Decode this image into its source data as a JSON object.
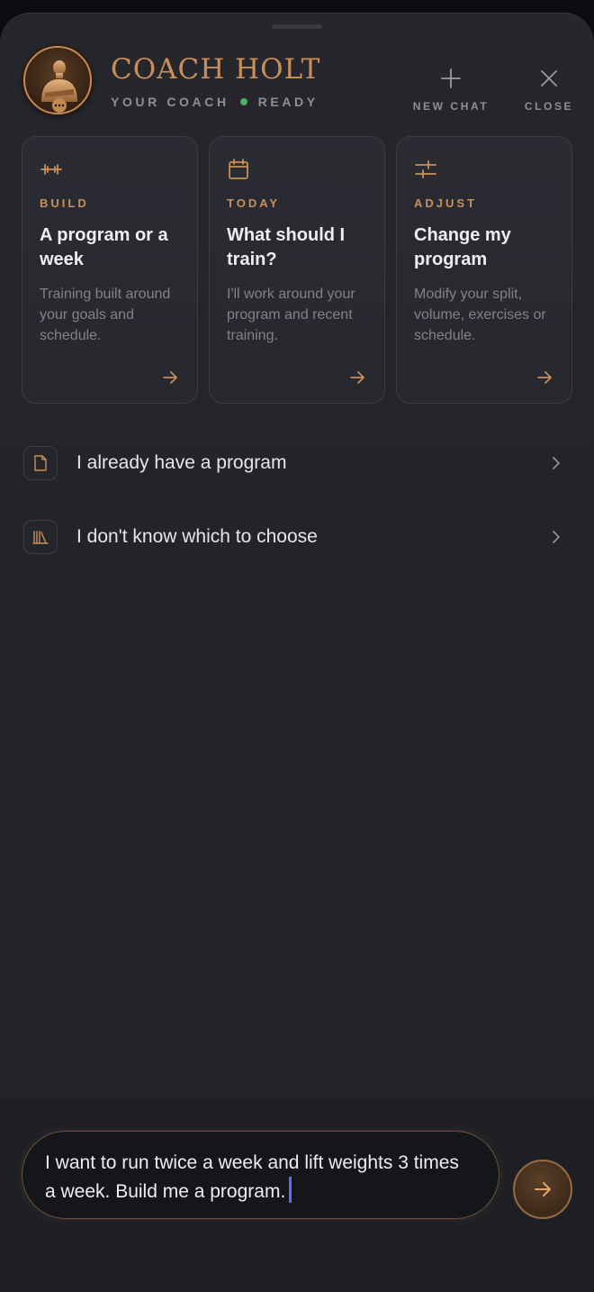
{
  "header": {
    "title": "COACH HOLT",
    "subtitle": "YOUR COACH",
    "status": "READY",
    "actions": {
      "new_chat": "NEW CHAT",
      "close": "CLOSE"
    }
  },
  "cards": [
    {
      "icon": "dumbbell-icon",
      "kicker": "BUILD",
      "title": "A program or a week",
      "description": "Training built around your goals and schedule."
    },
    {
      "icon": "calendar-icon",
      "kicker": "TODAY",
      "title": "What should I train?",
      "description": "I'll work around your program and recent training."
    },
    {
      "icon": "sliders-icon",
      "kicker": "ADJUST",
      "title": "Change my program",
      "description": "Modify your split, volume, exercises or schedule."
    }
  ],
  "options": [
    {
      "icon": "document-icon",
      "label": "I already have a program"
    },
    {
      "icon": "library-icon",
      "label": "I don't know which to choose"
    }
  ],
  "composer": {
    "value": "I want to run twice a week and lift weights 3 times a week. Build me a program."
  },
  "colors": {
    "accent": "#c98f5b",
    "status_ready": "#4caf6a",
    "caret": "#5b6cf5"
  }
}
